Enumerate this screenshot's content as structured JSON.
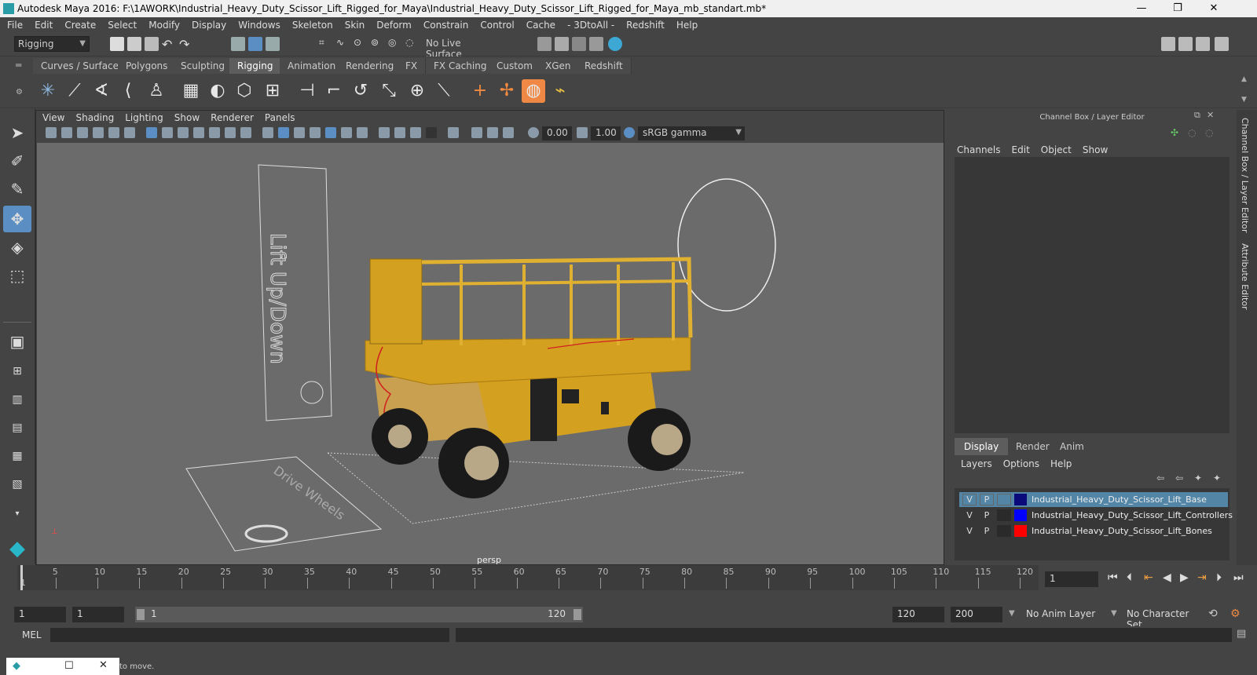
{
  "window": {
    "title": "Autodesk Maya 2016: F:\\1AWORK\\Industrial_Heavy_Duty_Scissor_Lift_Rigged_for_Maya\\Industrial_Heavy_Duty_Scissor_Lift_Rigged_for_Maya_mb_standart.mb*",
    "minimize": "—",
    "maximize": "❐",
    "close": "✕"
  },
  "menubar": [
    "File",
    "Edit",
    "Create",
    "Select",
    "Modify",
    "Display",
    "Windows",
    "Skeleton",
    "Skin",
    "Deform",
    "Constrain",
    "Control",
    "Cache",
    "- 3DtoAll -",
    "Redshift",
    "Help"
  ],
  "statusline": {
    "menuset": "Rigging",
    "live_surface": "No Live Surface"
  },
  "shelf_tabs": [
    "Curves / Surfaces",
    "Polygons",
    "Sculpting",
    "Rigging",
    "Animation",
    "Rendering",
    "FX",
    "FX Caching",
    "Custom",
    "XGen",
    "Redshift"
  ],
  "shelf_active": "Rigging",
  "panel_menu": [
    "View",
    "Shading",
    "Lighting",
    "Show",
    "Renderer",
    "Panels"
  ],
  "panel_toolbar": {
    "exposure": "0.00",
    "gamma": "1.00",
    "colorspace": "sRGB gamma"
  },
  "viewport": {
    "camera_label": "persp",
    "sign_text": "Lift Up/Down",
    "floor_text": "Drive Wheels"
  },
  "channelbox": {
    "title": "Channel Box / Layer Editor",
    "menu": [
      "Channels",
      "Edit",
      "Object",
      "Show"
    ]
  },
  "layer_editor": {
    "tabs": [
      "Display",
      "Render",
      "Anim"
    ],
    "menu": [
      "Layers",
      "Options",
      "Help"
    ],
    "layers": [
      {
        "v": "V",
        "p": "P",
        "color": "#0a0a7a",
        "name": "Industrial_Heavy_Duty_Scissor_Lift_Base",
        "selected": true
      },
      {
        "v": "V",
        "p": "P",
        "color": "#0000ff",
        "name": "Industrial_Heavy_Duty_Scissor_Lift_Controllers",
        "selected": false
      },
      {
        "v": "V",
        "p": "P",
        "color": "#ff0000",
        "name": "Industrial_Heavy_Duty_Scissor_Lift_Bones",
        "selected": false
      }
    ]
  },
  "side_tabs": [
    "Channel Box / Layer Editor",
    "Attribute Editor"
  ],
  "timeslider": {
    "ticks": [
      "5",
      "10",
      "15",
      "20",
      "25",
      "30",
      "35",
      "40",
      "45",
      "50",
      "55",
      "60",
      "65",
      "70",
      "75",
      "80",
      "85",
      "90",
      "95",
      "100",
      "105",
      "110",
      "115",
      "120"
    ],
    "start_label": "1",
    "current_frame": "1"
  },
  "range": {
    "start": "1",
    "anim_start": "1",
    "range_start": "1",
    "range_end": "120",
    "end": "120",
    "anim_end": "200",
    "anim_layer": "No Anim Layer",
    "char_set": "No Character Set"
  },
  "cmdline": {
    "label": "MEL"
  },
  "helpline": {
    "text": "to move."
  }
}
